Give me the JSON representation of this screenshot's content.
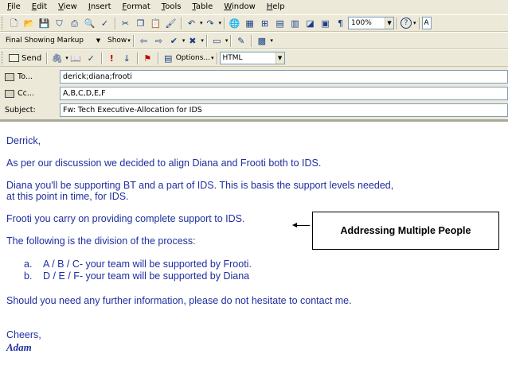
{
  "menu": [
    "File",
    "Edit",
    "View",
    "Insert",
    "Format",
    "Tools",
    "Table",
    "Window",
    "Help"
  ],
  "toolbar1": {
    "zoom": "100%",
    "help_glyph": "?",
    "font_partial": "A"
  },
  "toolbar2": {
    "markup_mode": "Final Showing Markup",
    "show_label": "Show"
  },
  "toolbar3": {
    "send_label": "Send",
    "options_label": "Options...",
    "format": "HTML"
  },
  "header": {
    "to_label": "To...",
    "to_value": "derick;diana;frooti",
    "cc_label": "Cc...",
    "cc_value": "A,B,C,D,E,F",
    "subject_label": "Subject:",
    "subject_value": "Fw: Tech Executive-Allocation for IDS"
  },
  "email": {
    "greeting": "Derrick,",
    "p1": "As per our discussion we decided to align Diana and Frooti both to IDS.",
    "p2_line1": "Diana you'll be supporting BT and a part of IDS. This is basis the support levels needed,",
    "p2_line2": "at this point in time, for IDS.",
    "p3": "Frooti you carry on providing complete support to IDS.",
    "p4": "The following is the division of the process:",
    "list": [
      {
        "marker": "a.",
        "text": "A / B / C- your team will be supported by Frooti."
      },
      {
        "marker": "b.",
        "text": "D / E / F- your team will be supported by Diana"
      }
    ],
    "p5": "Should you need any further information, please do not hesitate to contact me.",
    "closing": "Cheers,",
    "signature": "Adam"
  },
  "callout": {
    "text": "Addressing Multiple People"
  },
  "colors": {
    "chrome": "#ece9d8",
    "body_text": "#1f2ea0",
    "field_border": "#7f9db9"
  }
}
